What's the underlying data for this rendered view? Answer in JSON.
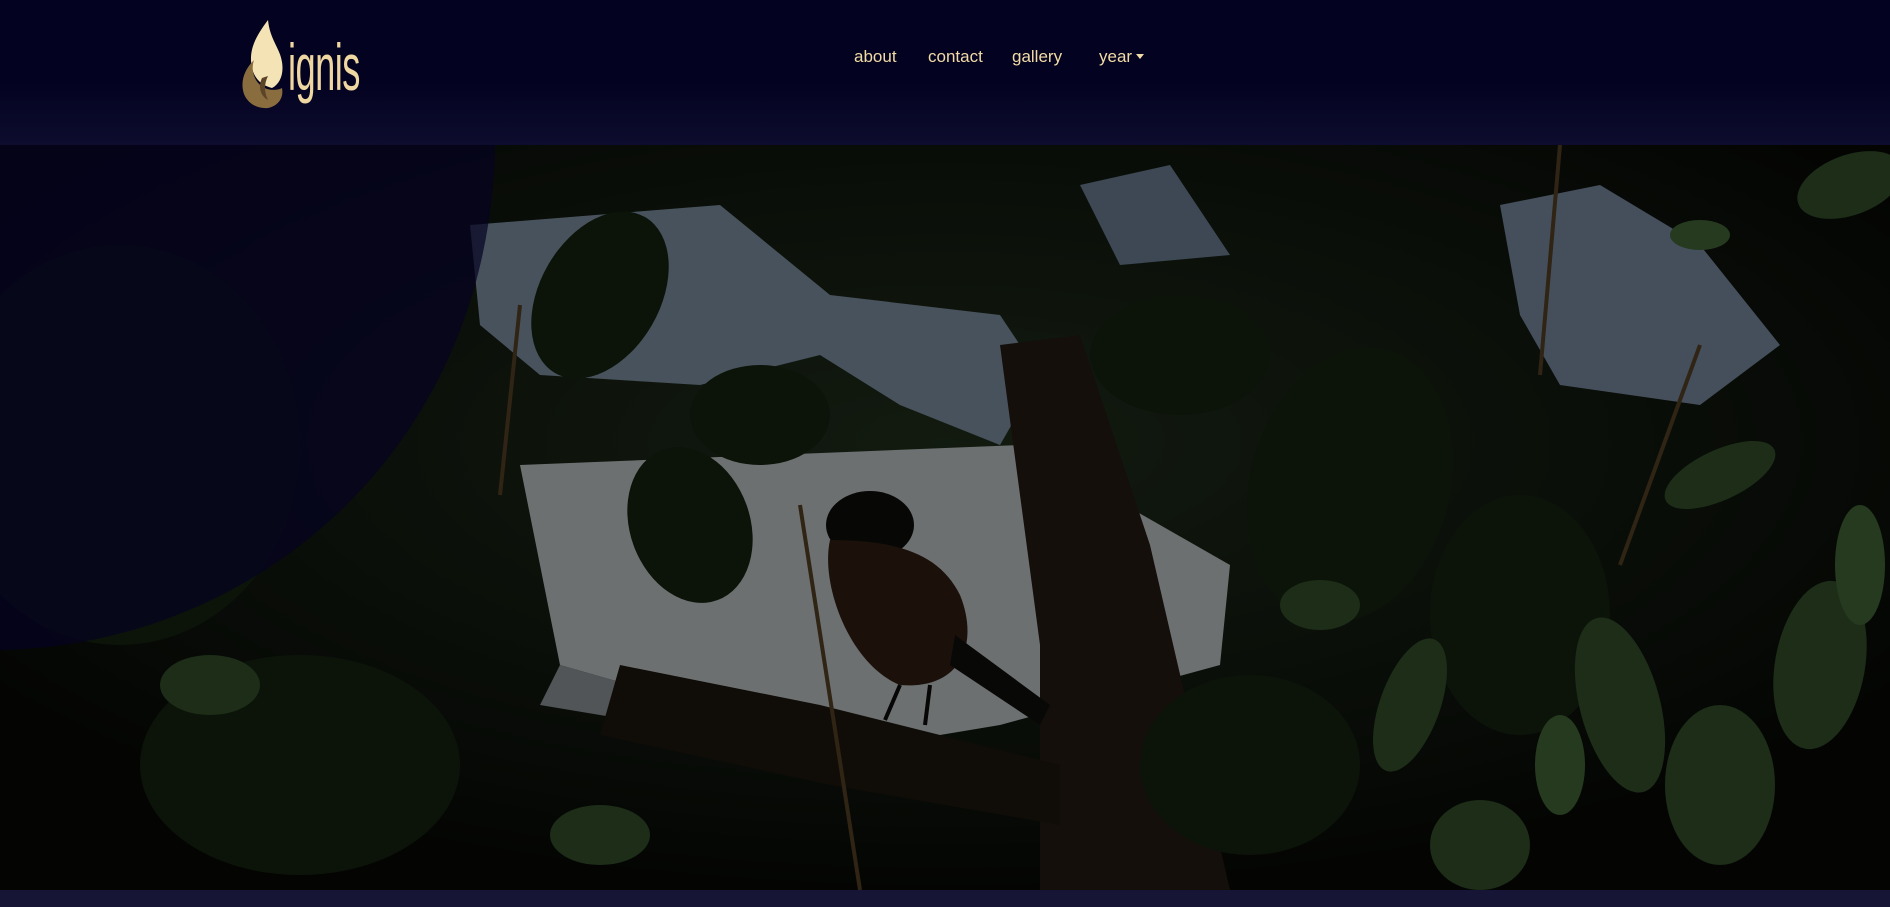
{
  "header": {
    "logo_text": "ignis",
    "colors": {
      "background": "#030220",
      "accent": "#f1dba6",
      "flame_light": "#f4e3b4",
      "flame_dark": "#8a6d3f"
    }
  },
  "nav": {
    "items": [
      {
        "label": "about"
      },
      {
        "label": "contact"
      },
      {
        "label": "gallery"
      },
      {
        "label": "year",
        "has_dropdown": true
      }
    ]
  },
  "hero": {
    "image_subject": "bird silhouette perched among leafy tree branches",
    "overlay_color": "#050321"
  }
}
